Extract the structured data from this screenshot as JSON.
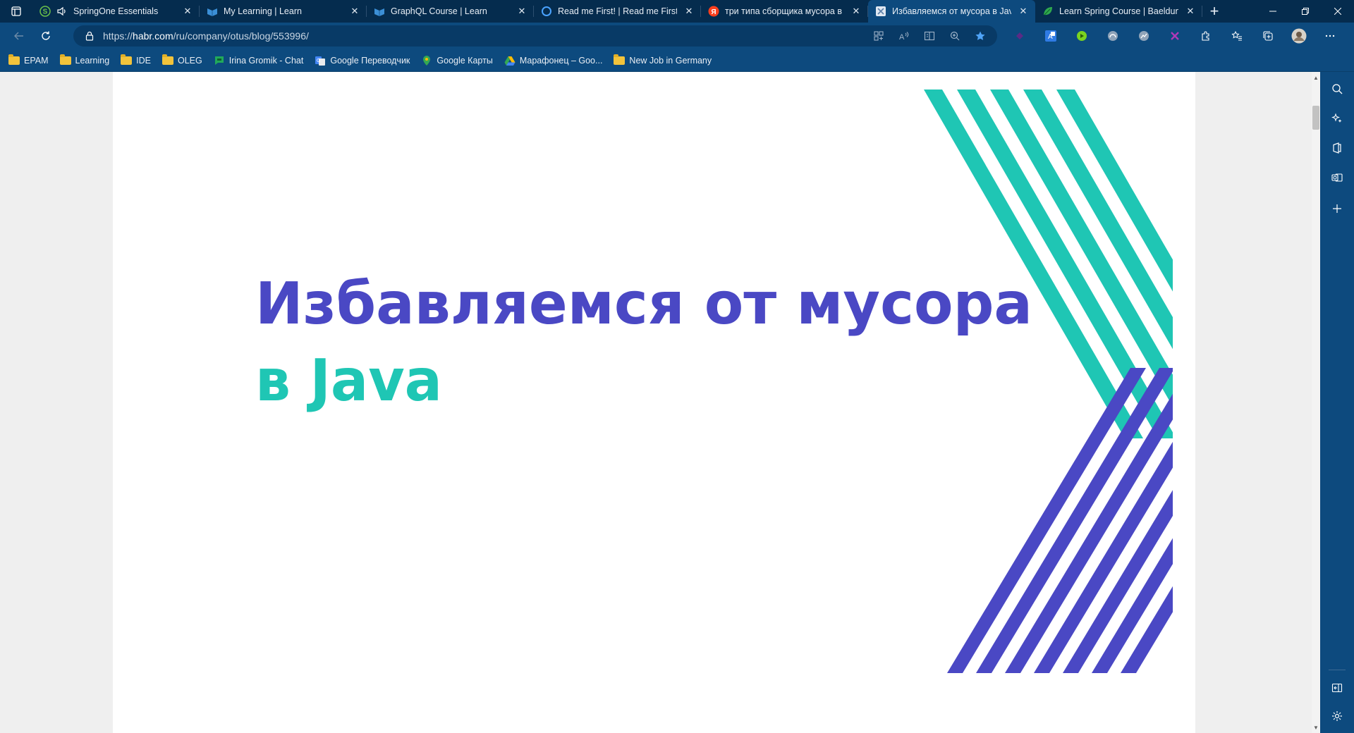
{
  "tabs": [
    {
      "title": "SpringOne Essentials",
      "icon": "spring-s-icon",
      "active": false
    },
    {
      "title": "My Learning | Learn",
      "icon": "learn-book-icon",
      "active": false
    },
    {
      "title": "GraphQL Course | Learn",
      "icon": "learn-book-icon",
      "active": false
    },
    {
      "title": "Read me First! | Read me First! | A",
      "icon": "circle-icon",
      "active": false
    },
    {
      "title": "три типа сборщика мусора в ja",
      "icon": "yandex-icon",
      "active": false
    },
    {
      "title": "Избавляемся от мусора в Java",
      "icon": "habr-icon",
      "active": true
    },
    {
      "title": "Learn Spring Course | Baeldung",
      "icon": "leaf-icon",
      "active": false
    }
  ],
  "address": {
    "prefix": "https://",
    "host": "habr.com",
    "path": "/ru/company/otus/blog/553996/"
  },
  "bookmarks": [
    {
      "label": "EPAM",
      "type": "folder"
    },
    {
      "label": "Learning",
      "type": "folder"
    },
    {
      "label": "IDE",
      "type": "folder"
    },
    {
      "label": "OLEG",
      "type": "folder"
    },
    {
      "label": "Irina Gromik - Chat",
      "type": "chat"
    },
    {
      "label": "Google Переводчик",
      "type": "translate"
    },
    {
      "label": "Google Карты",
      "type": "maps"
    },
    {
      "label": "Марафонец – Goo...",
      "type": "drive"
    },
    {
      "label": "New Job in Germany",
      "type": "folder"
    }
  ],
  "hero": {
    "line1": "Избавляемся от мусора",
    "line2": "в Java",
    "colors": {
      "purple": "#4a48c4",
      "teal": "#1fc6b4"
    }
  },
  "colors": {
    "tabstrip": "#052c4e",
    "toolbar": "#0d4a7e"
  }
}
